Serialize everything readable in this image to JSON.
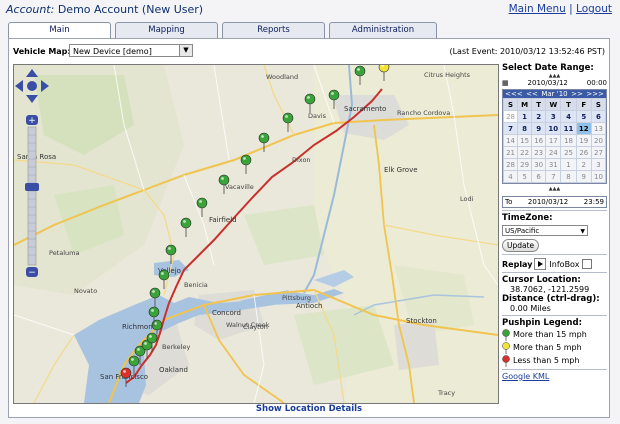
{
  "header": {
    "account_label": "Account:",
    "account_value": "Demo Account (New User)",
    "main_menu": "Main Menu",
    "separator": "|",
    "logout": "Logout"
  },
  "tabs": [
    {
      "label": "Main"
    },
    {
      "label": "Mapping"
    },
    {
      "label": "Reports"
    },
    {
      "label": "Administration"
    }
  ],
  "vehicle_map": {
    "label": "Vehicle Map:",
    "selected": "New Device [demo]"
  },
  "last_event": "(Last Event: 2010/03/12 13:52:46 PST)",
  "map": {
    "places": [
      "Woodland",
      "Sacramento",
      "Rancho Cordova",
      "Citrus Heights",
      "Dixon",
      "Vacaville",
      "Elk Grove",
      "Fairfield",
      "Santa Rosa",
      "Petaluma",
      "Novato",
      "Vallejo",
      "Benicia",
      "Pittsburg",
      "Antioch",
      "Concord",
      "Richmond",
      "Berkeley",
      "Oakland",
      "San Francisco",
      "Stockton",
      "Tracy",
      "Walnut Creek",
      "Lodi",
      "Clayton",
      "Davis"
    ],
    "zoom_in": "+",
    "zoom_out": "−",
    "route_color": "#c9302c"
  },
  "show_details": "Show Location Details",
  "sidebar": {
    "date_range_title": "Select Date Range:",
    "from_date": "2010/03/12",
    "from_time": "00:00",
    "cal_prev_year": "<<<",
    "cal_prev_month": "<<",
    "cal_month": "Mar '10",
    "cal_next_month": ">>",
    "cal_next_year": ">>>",
    "weekdays": [
      "S",
      "M",
      "T",
      "W",
      "T",
      "F",
      "S"
    ],
    "weeks": [
      [
        "28",
        "1",
        "2",
        "3",
        "4",
        "5",
        "6"
      ],
      [
        "7",
        "8",
        "9",
        "10",
        "11",
        "12",
        "13"
      ],
      [
        "14",
        "15",
        "16",
        "17",
        "18",
        "19",
        "20"
      ],
      [
        "21",
        "22",
        "23",
        "24",
        "25",
        "26",
        "27"
      ],
      [
        "28",
        "29",
        "30",
        "31",
        "1",
        "2",
        "3"
      ],
      [
        "4",
        "5",
        "6",
        "7",
        "8",
        "9",
        "10"
      ]
    ],
    "to_label": "To",
    "to_date": "2010/03/12",
    "to_time": "23:59",
    "timezone_label": "TimeZone:",
    "timezone_value": "US/Pacific",
    "update_button": "Update",
    "replay_label": "Replay",
    "infobox_label": "InfoBox",
    "cursor_label": "Cursor Location:",
    "cursor_value": "38.7062, -121.2599",
    "distance_label": "Distance (ctrl-drag):",
    "distance_value": "0.00 Miles",
    "legend_title": "Pushpin Legend:",
    "legend": [
      {
        "label": "More than 15 mph",
        "color": "#3aa33a"
      },
      {
        "label": "More than 5 mph",
        "color": "#f2e43a"
      },
      {
        "label": "Less than 5 mph",
        "color": "#d8322a"
      }
    ],
    "kml_link": "Google KML"
  }
}
